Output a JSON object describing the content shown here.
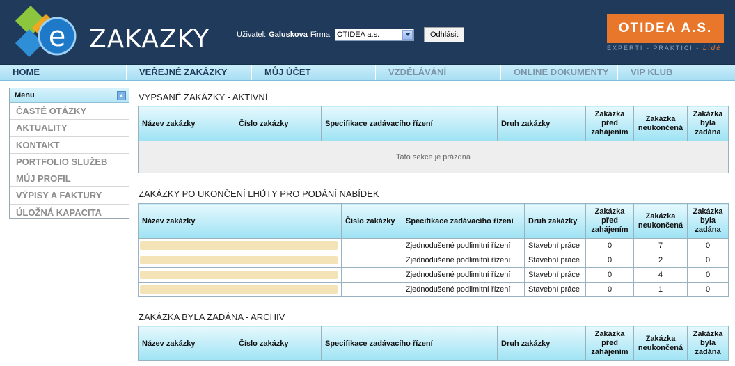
{
  "brand": {
    "logo_text": "ZAKAZKY"
  },
  "user": {
    "user_label": "Uživatel:",
    "user_name": "Galuskova",
    "firm_label": "Firma:",
    "firm_value": "OTIDEA a.s.",
    "logout": "Odhlásit"
  },
  "partner": {
    "name": "OTIDEA A.S.",
    "tagline_main": "EXPERTI - PRAKTICI -",
    "tagline_accent": "Lidé"
  },
  "nav": [
    {
      "label": "HOME"
    },
    {
      "label": "VEŘEJNÉ ZAKÁZKY"
    },
    {
      "label": "MŮJ ÚČET"
    },
    {
      "label": "VZDĚLÁVÁNÍ"
    },
    {
      "label": "ONLINE DOKUMENTY"
    },
    {
      "label": "VIP KLUB"
    }
  ],
  "sidebar": {
    "title": "Menu",
    "items": [
      {
        "label": "ČASTÉ OTÁZKY"
      },
      {
        "label": "AKTUALITY"
      },
      {
        "label": "KONTAKT"
      },
      {
        "label": "PORTFOLIO SLUŽEB"
      },
      {
        "label": "MŮJ PROFIL"
      },
      {
        "label": "VÝPISY A FAKTURY"
      },
      {
        "label": "ÚLOŽNÁ KAPACITA"
      }
    ]
  },
  "columns": {
    "nazev": "Název zakázky",
    "cislo": "Číslo zakázky",
    "specifikace": "Specifikace zadávacího řízení",
    "druh": "Druh zakázky",
    "pred": "Zakázka před zahájením",
    "neukoncena": "Zakázka neukončená",
    "zadana": "Zakázka byla zadána"
  },
  "sections": {
    "active": {
      "title": "VYPSANÉ ZAKÁZKY - AKTIVNÍ",
      "empty_text": "Tato sekce je prázdná"
    },
    "after": {
      "title": "ZAKÁZKY PO UKONČENÍ LHŮTY PRO PODÁNÍ NABÍDEK",
      "rows": [
        {
          "spec": "Zjednodušené podlimitní řízení",
          "druh": "Stavební práce",
          "pred": "0",
          "neukoncena": "7",
          "zadana": "0"
        },
        {
          "spec": "Zjednodušené podlimitní řízení",
          "druh": "Stavební práce",
          "pred": "0",
          "neukoncena": "2",
          "zadana": "0"
        },
        {
          "spec": "Zjednodušené podlimitní řízení",
          "druh": "Stavební práce",
          "pred": "0",
          "neukoncena": "4",
          "zadana": "0"
        },
        {
          "spec": "Zjednodušené podlimitní řízení",
          "druh": "Stavební práce",
          "pred": "0",
          "neukoncena": "1",
          "zadana": "0"
        }
      ]
    },
    "archive": {
      "title": "ZAKÁZKA BYLA ZADÁNA - ARCHIV"
    }
  },
  "colors": {
    "header_bg": "#1f3a5a",
    "nav_bg": "#a8def3",
    "accent_orange": "#e8772b",
    "table_head": "#9ee3f4"
  }
}
